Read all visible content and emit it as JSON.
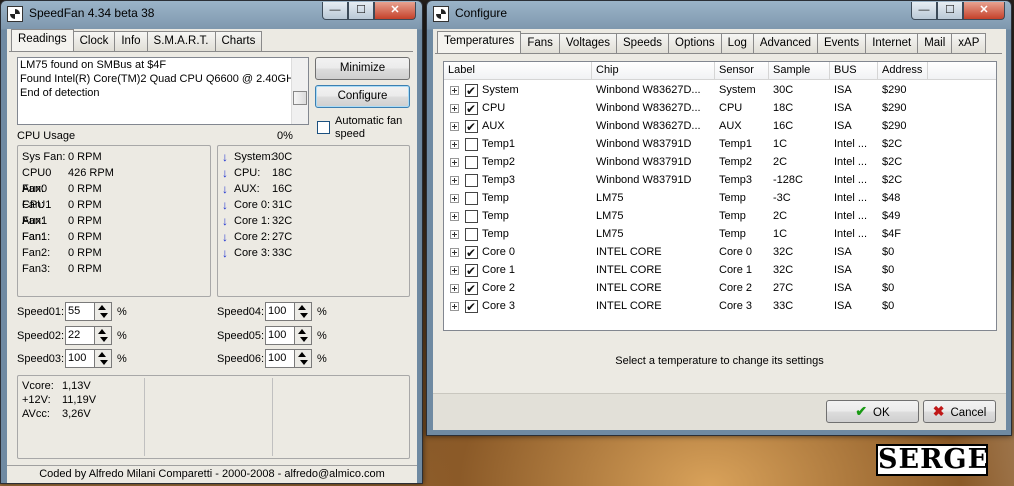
{
  "speedfan": {
    "title": "SpeedFan 4.34 beta 38",
    "caption": {
      "minimize": "—",
      "maximize": "☐",
      "close": "✕"
    },
    "tabs": [
      "Readings",
      "Clock",
      "Info",
      "S.M.A.R.T.",
      "Charts"
    ],
    "log": [
      "LM75 found on SMBus at $4F",
      "Found Intel(R) Core(TM)2 Quad CPU Q6600 @ 2.40GHz",
      "End of detection"
    ],
    "buttons": {
      "minimize": "Minimize",
      "configure": "Configure"
    },
    "auto_fan": {
      "label_line1": "Automatic fan",
      "label_line2": "speed",
      "checked": false
    },
    "cpu_usage": {
      "label": "CPU Usage",
      "value": "0%"
    },
    "fans": [
      {
        "name": "Sys Fan:",
        "value": "0 RPM"
      },
      {
        "name": "CPU0 Fan:",
        "value": "426 RPM"
      },
      {
        "name": "Aux0 Fan:",
        "value": "0 RPM"
      },
      {
        "name": "CPU1 Fan:",
        "value": "0 RPM"
      },
      {
        "name": "Aux1 Fan:",
        "value": "0 RPM"
      },
      {
        "name": "Fan1:",
        "value": "0 RPM"
      },
      {
        "name": "Fan2:",
        "value": "0 RPM"
      },
      {
        "name": "Fan3:",
        "value": "0 RPM"
      }
    ],
    "temps": [
      {
        "name": "System:",
        "value": "30C"
      },
      {
        "name": "CPU:",
        "value": "18C"
      },
      {
        "name": "AUX:",
        "value": "16C"
      },
      {
        "name": "Core 0:",
        "value": "31C"
      },
      {
        "name": "Core 1:",
        "value": "32C"
      },
      {
        "name": "Core 2:",
        "value": "27C"
      },
      {
        "name": "Core 3:",
        "value": "33C"
      }
    ],
    "speeds": [
      {
        "name": "Speed01:",
        "value": "55",
        "unit": "%"
      },
      {
        "name": "Speed02:",
        "value": "22",
        "unit": "%"
      },
      {
        "name": "Speed03:",
        "value": "100",
        "unit": "%"
      },
      {
        "name": "Speed04:",
        "value": "100",
        "unit": "%"
      },
      {
        "name": "Speed05:",
        "value": "100",
        "unit": "%"
      },
      {
        "name": "Speed06:",
        "value": "100",
        "unit": "%"
      }
    ],
    "voltages": [
      {
        "name": "Vcore:",
        "value": "1,13V"
      },
      {
        "name": "+12V:",
        "value": "11,19V"
      },
      {
        "name": "AVcc:",
        "value": "3,26V"
      }
    ],
    "status": "Coded by Alfredo Milani Comparetti - 2000-2008 - alfredo@almico.com"
  },
  "configure": {
    "title": "Configure",
    "caption": {
      "minimize": "—",
      "maximize": "☐",
      "close": "✕"
    },
    "tabs": [
      "Temperatures",
      "Fans",
      "Voltages",
      "Speeds",
      "Options",
      "Log",
      "Advanced",
      "Events",
      "Internet",
      "Mail",
      "xAP"
    ],
    "columns": [
      "Label",
      "Chip",
      "Sensor",
      "Sample",
      "BUS",
      "Address"
    ],
    "rows": [
      {
        "checked": true,
        "label": "System",
        "chip": "Winbond W83627D...",
        "sensor": "System",
        "sample": "30C",
        "bus": "ISA",
        "address": "$290"
      },
      {
        "checked": true,
        "label": "CPU",
        "chip": "Winbond W83627D...",
        "sensor": "CPU",
        "sample": "18C",
        "bus": "ISA",
        "address": "$290"
      },
      {
        "checked": true,
        "label": "AUX",
        "chip": "Winbond W83627D...",
        "sensor": "AUX",
        "sample": "16C",
        "bus": "ISA",
        "address": "$290"
      },
      {
        "checked": false,
        "label": "Temp1",
        "chip": "Winbond W83791D",
        "sensor": "Temp1",
        "sample": "1C",
        "bus": "Intel ...",
        "address": "$2C"
      },
      {
        "checked": false,
        "label": "Temp2",
        "chip": "Winbond W83791D",
        "sensor": "Temp2",
        "sample": "2C",
        "bus": "Intel ...",
        "address": "$2C"
      },
      {
        "checked": false,
        "label": "Temp3",
        "chip": "Winbond W83791D",
        "sensor": "Temp3",
        "sample": "-128C",
        "bus": "Intel ...",
        "address": "$2C"
      },
      {
        "checked": false,
        "label": "Temp",
        "chip": "LM75",
        "sensor": "Temp",
        "sample": "-3C",
        "bus": "Intel ...",
        "address": "$48"
      },
      {
        "checked": false,
        "label": "Temp",
        "chip": "LM75",
        "sensor": "Temp",
        "sample": "2C",
        "bus": "Intel ...",
        "address": "$49"
      },
      {
        "checked": false,
        "label": "Temp",
        "chip": "LM75",
        "sensor": "Temp",
        "sample": "1C",
        "bus": "Intel ...",
        "address": "$4F"
      },
      {
        "checked": true,
        "label": "Core 0",
        "chip": "INTEL CORE",
        "sensor": "Core 0",
        "sample": "32C",
        "bus": "ISA",
        "address": "$0"
      },
      {
        "checked": true,
        "label": "Core 1",
        "chip": "INTEL CORE",
        "sensor": "Core 1",
        "sample": "32C",
        "bus": "ISA",
        "address": "$0"
      },
      {
        "checked": true,
        "label": "Core 2",
        "chip": "INTEL CORE",
        "sensor": "Core 2",
        "sample": "27C",
        "bus": "ISA",
        "address": "$0"
      },
      {
        "checked": true,
        "label": "Core 3",
        "chip": "INTEL CORE",
        "sensor": "Core 3",
        "sample": "33C",
        "bus": "ISA",
        "address": "$0"
      }
    ],
    "hint": "Select a temperature to change its settings",
    "ok": "OK",
    "cancel": "Cancel"
  },
  "watermark": "SERGE"
}
